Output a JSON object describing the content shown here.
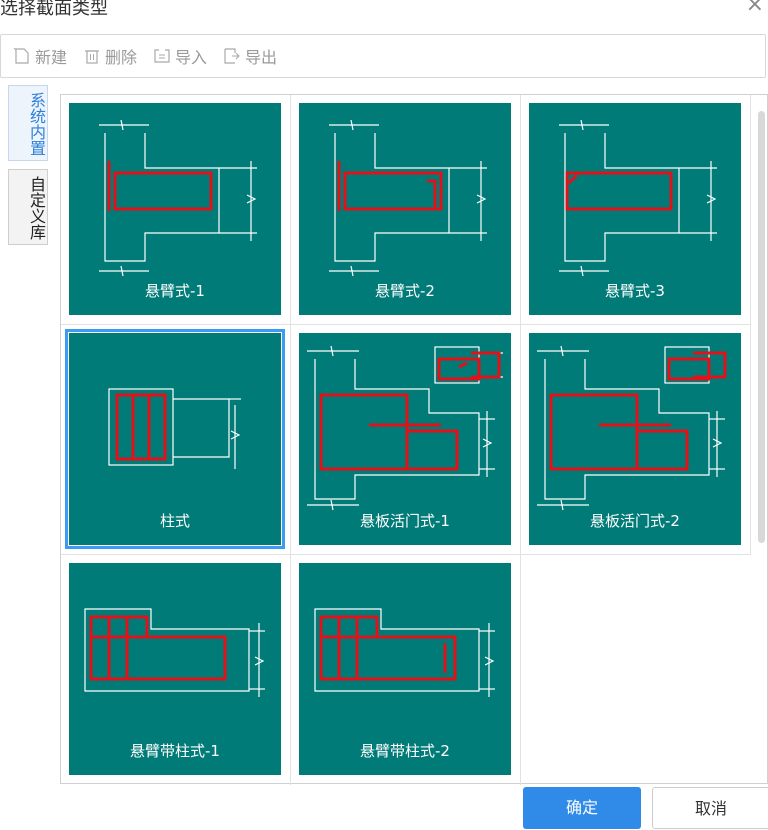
{
  "dialog": {
    "title": "选择截面类型",
    "close": "×"
  },
  "toolbar": {
    "new_label": "新建",
    "delete_label": "删除",
    "import_label": "导入",
    "export_label": "导出"
  },
  "side_tabs": [
    "系统内置",
    "自定义库"
  ],
  "sections": [
    {
      "label": "悬臂式-1"
    },
    {
      "label": "悬臂式-2"
    },
    {
      "label": "悬臂式-3"
    },
    {
      "label": "柱式"
    },
    {
      "label": "悬板活门式-1"
    },
    {
      "label": "悬板活门式-2"
    },
    {
      "label": "悬臂带柱式-1"
    },
    {
      "label": "悬臂带柱式-2"
    }
  ],
  "buttons": {
    "ok": "确定",
    "cancel": "取消"
  },
  "colors": {
    "card": "#007b78",
    "rebar": "#e0121a",
    "accent": "#2f8ae8",
    "selected": "#3b9cf5"
  }
}
